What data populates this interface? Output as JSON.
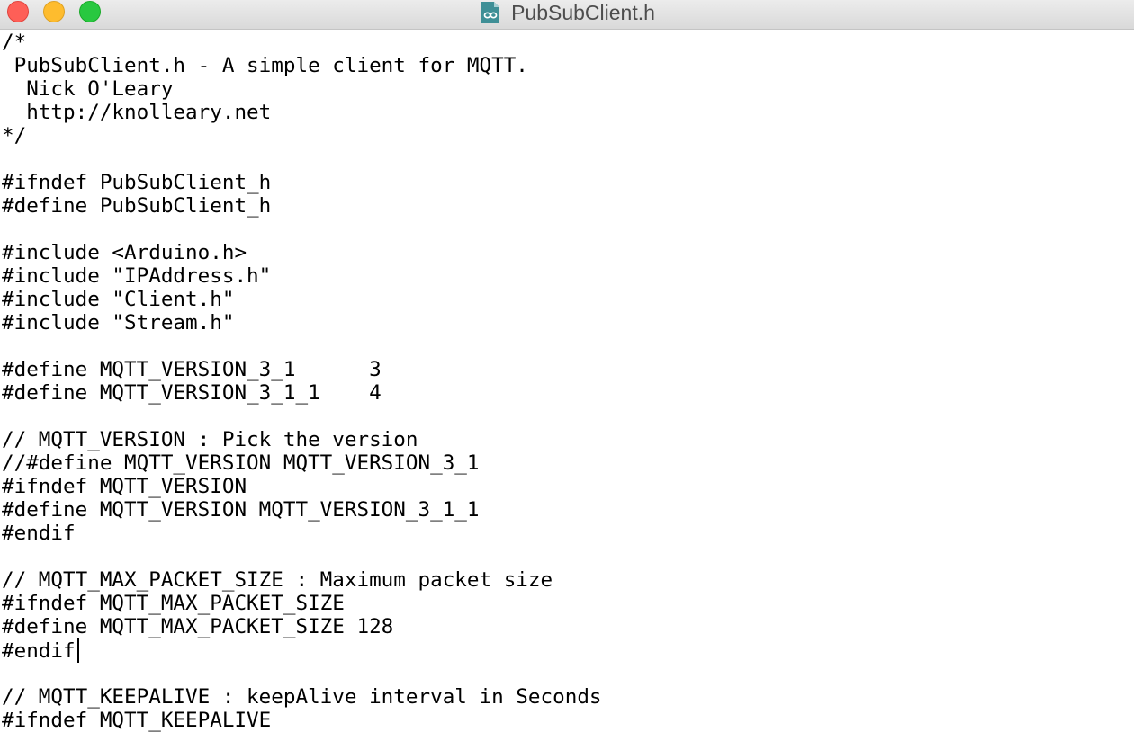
{
  "window": {
    "title": "PubSubClient.h",
    "icon": "arduino-document-icon"
  },
  "editor": {
    "lines": [
      "/*",
      " PubSubClient.h - A simple client for MQTT.",
      "  Nick O'Leary",
      "  http://knolleary.net",
      "*/",
      "",
      "#ifndef PubSubClient_h",
      "#define PubSubClient_h",
      "",
      "#include <Arduino.h>",
      "#include \"IPAddress.h\"",
      "#include \"Client.h\"",
      "#include \"Stream.h\"",
      "",
      "#define MQTT_VERSION_3_1      3",
      "#define MQTT_VERSION_3_1_1    4",
      "",
      "// MQTT_VERSION : Pick the version",
      "//#define MQTT_VERSION MQTT_VERSION_3_1",
      "#ifndef MQTT_VERSION",
      "#define MQTT_VERSION MQTT_VERSION_3_1_1",
      "#endif",
      "",
      "// MQTT_MAX_PACKET_SIZE : Maximum packet size",
      "#ifndef MQTT_MAX_PACKET_SIZE",
      "#define MQTT_MAX_PACKET_SIZE 128",
      "#endif",
      "",
      "// MQTT_KEEPALIVE : keepAlive interval in Seconds",
      "#ifndef MQTT_KEEPALIVE"
    ],
    "caret_line": 26
  },
  "colors": {
    "close": "#fe5f57",
    "minimize": "#febc2e",
    "maximize": "#28c840",
    "icon_teal": "#3f8f96"
  }
}
